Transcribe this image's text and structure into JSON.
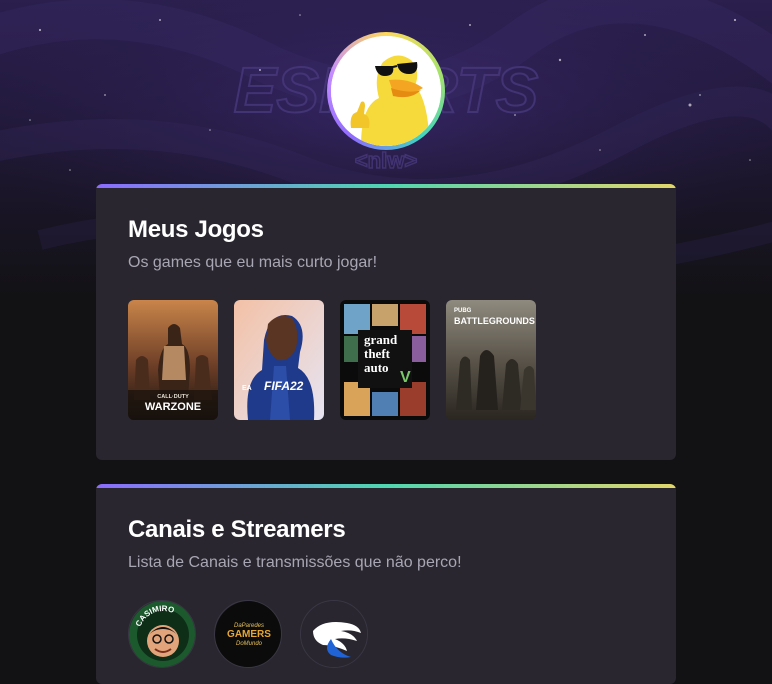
{
  "profile": {
    "avatar_alt": "duck-with-sunglasses",
    "background_logo_text": "ESPORTS",
    "background_logo_subtext": "<nlw>"
  },
  "sections": {
    "games": {
      "title": "Meus Jogos",
      "subtitle": "Os games que eu mais curto jogar!",
      "items": [
        {
          "name": "Call of Duty Warzone",
          "cover_top": "CALL·DUTY",
          "cover_bottom": "WARZONE"
        },
        {
          "name": "FIFA 22",
          "cover_text": "FIFA22"
        },
        {
          "name": "Grand Theft Auto V",
          "cover_lines": [
            "grand",
            "theft",
            "auto"
          ],
          "cover_badge": "V"
        },
        {
          "name": "PUBG Battlegrounds",
          "cover_small": "PUBG",
          "cover_text": "BATTLEGROUNDS"
        }
      ]
    },
    "channels": {
      "title": "Canais e Streamers",
      "subtitle": "Lista de Canais e transmissões que não perco!",
      "items": [
        {
          "name": "Casimiro",
          "arc_text": "CASIMIRO"
        },
        {
          "name": "Gamers do Mundo",
          "logo_top": "DaParedes",
          "logo_mid": "GAMERS",
          "logo_bottom": "DoMundo"
        },
        {
          "name": "Wings channel",
          "icon": "wing-icon"
        }
      ]
    }
  },
  "colors": {
    "bg": "#121214",
    "card": "#29262f",
    "gradient_start": "#8b6bff",
    "gradient_mid": "#4fd6b0",
    "gradient_end": "#e2d66b",
    "subtitle": "#a9a6b3"
  }
}
